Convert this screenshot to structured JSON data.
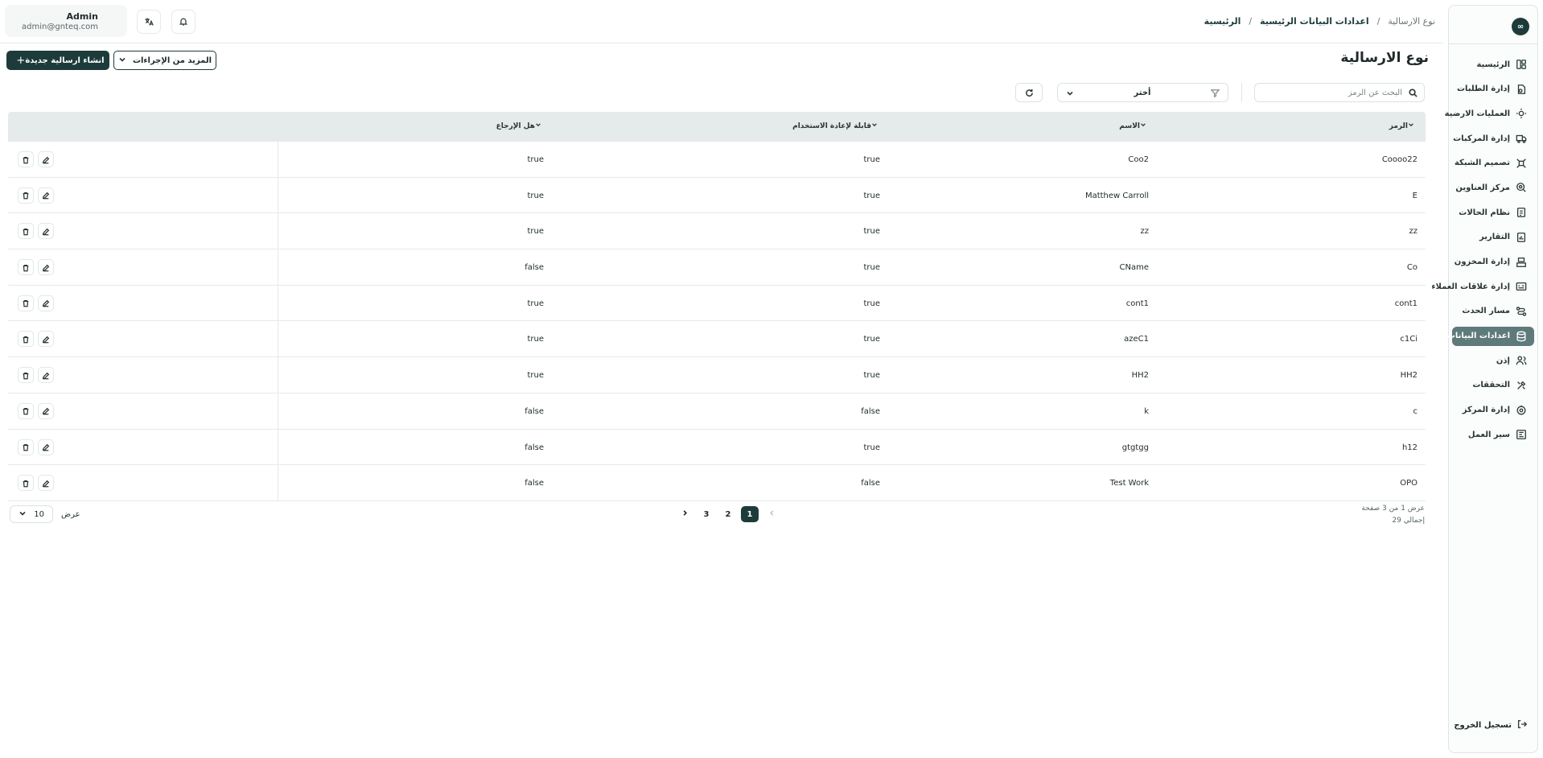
{
  "header": {
    "user_name": "Admin",
    "user_email": "admin@gnteq.com",
    "breadcrumb": [
      "الرئيسية",
      "اعدادات البيانات الرئيسية",
      "نوع الارسالية"
    ]
  },
  "sidebar": {
    "logo_text": "∞",
    "items": [
      {
        "label": "الرئيسية",
        "icon": "dashboard-icon"
      },
      {
        "label": "إدارة الطلبات",
        "icon": "orders-icon"
      },
      {
        "label": "العمليات الارضية",
        "icon": "ground-ops-icon"
      },
      {
        "label": "إدارة المركبات",
        "icon": "truck-icon"
      },
      {
        "label": "تصميم الشبكة",
        "icon": "network-icon"
      },
      {
        "label": "مركز العناوين",
        "icon": "map-pin-icon"
      },
      {
        "label": "نظام الحالات",
        "icon": "status-icon"
      },
      {
        "label": "التقارير",
        "icon": "reports-icon"
      },
      {
        "label": "إدارة المخزون",
        "icon": "inventory-icon"
      },
      {
        "label": "إدارة علاقات العملاء",
        "icon": "crm-icon"
      },
      {
        "label": "مسار الحدث",
        "icon": "route-icon"
      },
      {
        "label": "اعدادات البيانات",
        "icon": "database-icon",
        "active": true
      },
      {
        "label": "إذن",
        "icon": "users-icon"
      },
      {
        "label": "التحققات",
        "icon": "tools-icon"
      },
      {
        "label": "إدارة المركز",
        "icon": "center-icon"
      },
      {
        "label": "سير العمل",
        "icon": "workflow-icon"
      }
    ],
    "logout_label": "تسجيل الخروج"
  },
  "page": {
    "title": "نوع الارسالية",
    "create_button": "انشاء ارسالية جديدة",
    "more_actions_button": "المزيد من الإجراءات",
    "search_placeholder": "البحث عن الرمز",
    "filter_select": "أختر"
  },
  "table": {
    "columns": [
      "الرمز",
      "الاسم",
      "قابلة لإعادة الاستخدام",
      "هل الإرجاع"
    ],
    "rows": [
      {
        "code": "Coooo22",
        "name": "Coo2",
        "reusable": "true",
        "returnable": "true"
      },
      {
        "code": "E",
        "name": "Matthew Carroll",
        "reusable": "true",
        "returnable": "true"
      },
      {
        "code": "zz",
        "name": "zz",
        "reusable": "true",
        "returnable": "true"
      },
      {
        "code": "Co",
        "name": "CName",
        "reusable": "true",
        "returnable": "false"
      },
      {
        "code": "cont1",
        "name": "cont1",
        "reusable": "true",
        "returnable": "true"
      },
      {
        "code": "c1Ci",
        "name": "azeC1",
        "reusable": "true",
        "returnable": "true"
      },
      {
        "code": "HH2",
        "name": "HH2",
        "reusable": "true",
        "returnable": "true"
      },
      {
        "code": "c",
        "name": "k",
        "reusable": "false",
        "returnable": "false"
      },
      {
        "code": "h12",
        "name": "gtgtgg",
        "reusable": "true",
        "returnable": "false"
      },
      {
        "code": "OPO",
        "name": "Test Work",
        "reusable": "false",
        "returnable": "false"
      }
    ]
  },
  "pagination": {
    "info_pages": "عرض 1 من 3 صفحة",
    "info_total": "إجمالي 29",
    "pages": [
      "1",
      "2",
      "3"
    ],
    "current_page": "1",
    "per_page_value": "10",
    "per_page_label": "عرض"
  },
  "colors": {
    "primary": "#1d3b3b",
    "active_nav": "#5f7a7a",
    "table_header": "#e5eaea"
  }
}
